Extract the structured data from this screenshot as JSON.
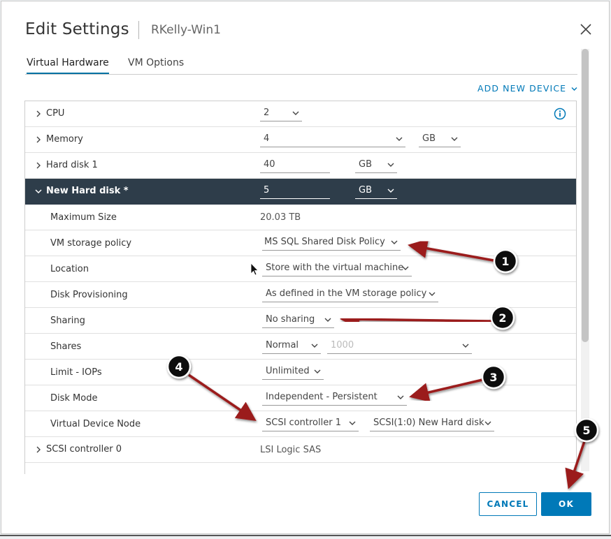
{
  "dialog": {
    "title": "Edit Settings",
    "vm_name": "RKelly-Win1"
  },
  "tabs": [
    {
      "label": "Virtual Hardware",
      "active": true
    },
    {
      "label": "VM Options",
      "active": false
    }
  ],
  "add_device_label": "ADD NEW DEVICE",
  "rows": {
    "cpu": {
      "label": "CPU",
      "value": "2"
    },
    "memory": {
      "label": "Memory",
      "value": "4",
      "unit": "GB"
    },
    "hard_disk_1": {
      "label": "Hard disk 1",
      "value": "40",
      "unit": "GB"
    },
    "new_hard_disk": {
      "label": "New Hard disk *",
      "value": "5",
      "unit": "GB"
    },
    "max_size": {
      "label": "Maximum Size",
      "value": "20.03 TB"
    },
    "storage_policy": {
      "label": "VM storage policy",
      "value": "MS SQL Shared Disk Policy"
    },
    "location": {
      "label": "Location",
      "value": "Store with the virtual machine"
    },
    "provisioning": {
      "label": "Disk Provisioning",
      "value": "As defined in the VM storage policy"
    },
    "sharing": {
      "label": "Sharing",
      "value": "No sharing"
    },
    "shares": {
      "label": "Shares",
      "value": "Normal",
      "amount": "1000"
    },
    "limit_iops": {
      "label": "Limit - IOPs",
      "value": "Unlimited"
    },
    "disk_mode": {
      "label": "Disk Mode",
      "value": "Independent - Persistent"
    },
    "device_node": {
      "label": "Virtual Device Node",
      "controller": "SCSI controller 1",
      "node": "SCSI(1:0) New Hard disk"
    },
    "scsi_controller_0": {
      "label": "SCSI controller 0",
      "value": "LSI Logic SAS"
    }
  },
  "buttons": {
    "cancel": "CANCEL",
    "ok": "OK"
  },
  "annotations": [
    "1",
    "2",
    "3",
    "4",
    "5"
  ],
  "colors": {
    "accent": "#0079b8",
    "selected_row": "#2e3d4a",
    "arrow": "#9b1c1c",
    "badge": "#111111"
  }
}
